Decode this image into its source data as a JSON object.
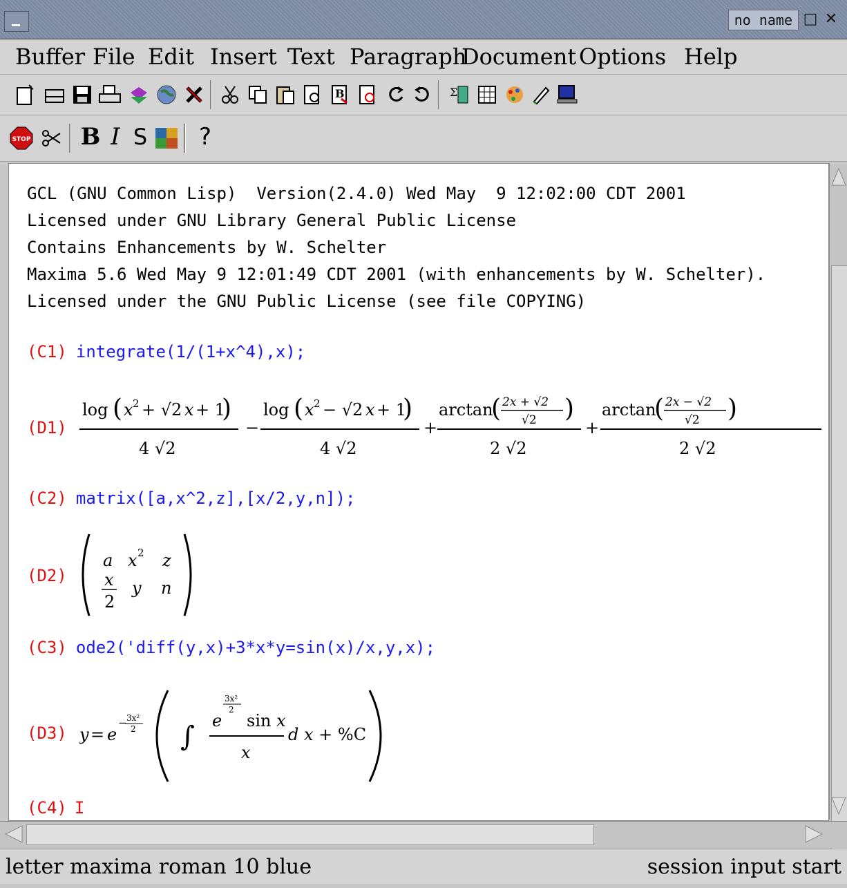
{
  "window": {
    "title": "no name"
  },
  "menu": [
    "Buffer",
    "File",
    "Edit",
    "Insert",
    "Text",
    "Paragraph",
    "Document",
    "Options",
    "Help"
  ],
  "toolbar1": [
    "new-document-icon",
    "open-icon",
    "save-icon",
    "print-icon",
    "book-icon",
    "globe-icon",
    "close-x-icon",
    "cut-icon",
    "copy-icon",
    "paste-icon",
    "preview-icon",
    "find-replace-icon",
    "spell-check-icon",
    "undo-icon",
    "redo-icon",
    "insert-math-icon",
    "insert-table-icon",
    "insert-image-icon",
    "pen-icon",
    "monitor-icon"
  ],
  "toolbar2": {
    "stop_icon": "stop-icon",
    "cut_icon": "scissors-icon",
    "bold": "B",
    "italic": "I",
    "strike": "S",
    "color_icon": "color-palette-icon",
    "help": "?"
  },
  "banner": [
    "GCL (GNU Common Lisp)  Version(2.4.0) Wed May  9 12:02:00 CDT 2001",
    "Licensed under GNU Library General Public License",
    "Contains Enhancements by W. Schelter",
    "Maxima 5.6 Wed May 9 12:01:49 CDT 2001 (with enhancements by W. Schelter).",
    "Licensed under the GNU Public License (see file COPYING)"
  ],
  "session": {
    "c1_label": "(C1)",
    "c1_input": "integrate(1/(1+x^4),x);",
    "d1_label": "(D1)",
    "c2_label": "(C2)",
    "c2_input": "matrix([a,x^2,z],[x/2,y,n]);",
    "d2_label": "(D2)",
    "c3_label": "(C3)",
    "c3_input": "ode2('diff(y,x)+3*x*y=sin(x)/x,y,x);",
    "d3_label": "(D3)",
    "c4_label": "(C4)",
    "c4_cursor": "I"
  },
  "math": {
    "log": "log",
    "arctan": "arctan",
    "four_sqrt2": "4√2",
    "two_sqrt2": "2√2",
    "x2": "x",
    "plus_sqrt2x1": "+ √2 x + 1",
    "minus_sqrt2x1": "− √2 x + 1",
    "m_a": "a",
    "m_x2": "x",
    "m_z": "z",
    "m_x": "x",
    "m_2": "2",
    "m_y": "y",
    "m_n": "n",
    "d3_y": "y",
    "d3_eq": "=",
    "d3_e": "e",
    "d3_exp": "−",
    "d3_sin": "sin x",
    "d3_dx": "d x + %C"
  },
  "status": {
    "left": "letter maxima roman 10 blue",
    "right": "session input start"
  }
}
